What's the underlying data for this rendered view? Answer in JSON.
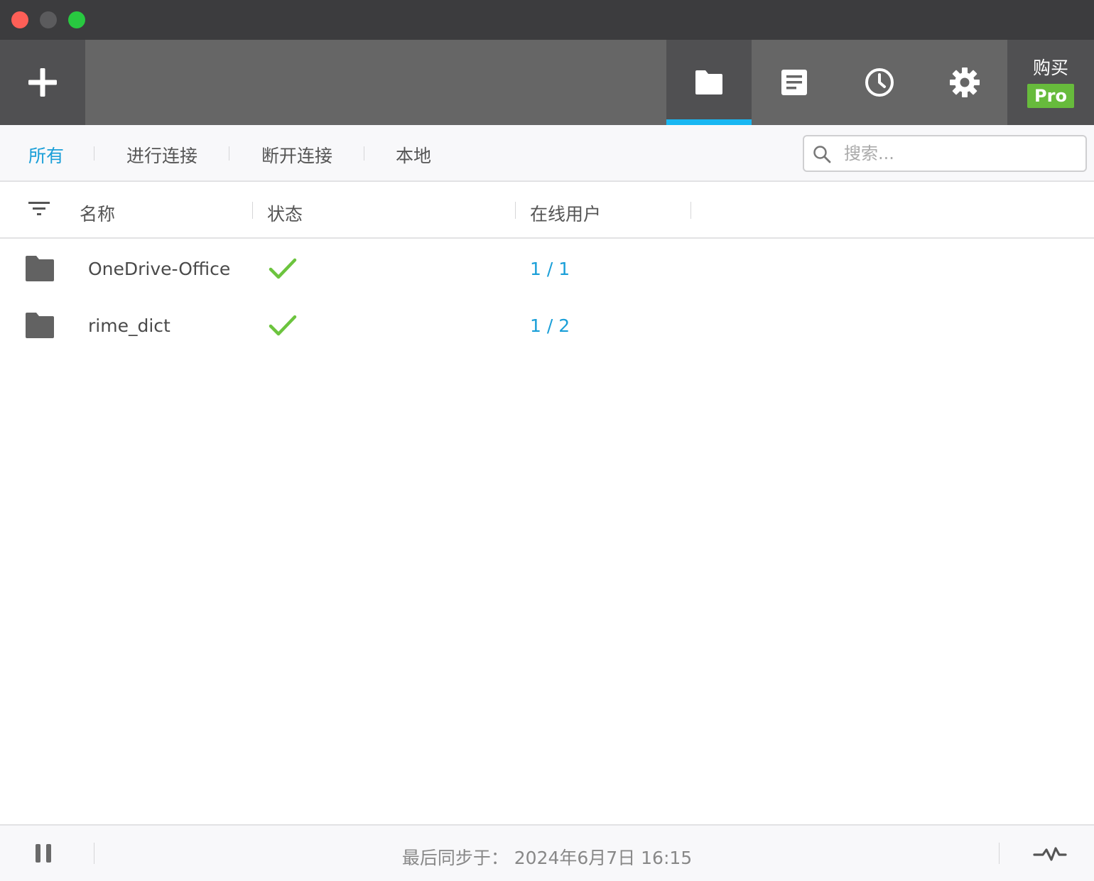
{
  "window": {
    "controls": [
      "close",
      "minimize",
      "maximize"
    ]
  },
  "toolbar": {
    "add_icon": "plus-icon",
    "tabs": [
      {
        "name": "folders",
        "icon": "folder-icon",
        "active": true
      },
      {
        "name": "logs",
        "icon": "document-icon",
        "active": false
      },
      {
        "name": "history",
        "icon": "clock-icon",
        "active": false
      },
      {
        "name": "settings",
        "icon": "gear-icon",
        "active": false
      }
    ],
    "buy_label": "购买",
    "pro_label": "Pro"
  },
  "filters": {
    "tabs": [
      {
        "label": "所有",
        "active": true
      },
      {
        "label": "进行连接",
        "active": false
      },
      {
        "label": "断开连接",
        "active": false
      },
      {
        "label": "本地",
        "active": false
      }
    ],
    "search_placeholder": "搜索..."
  },
  "table": {
    "columns": [
      "名称",
      "状态",
      "在线用户"
    ],
    "rows": [
      {
        "name": "OneDrive-Office",
        "status": "synced",
        "users": "1 / 1"
      },
      {
        "name": "rime_dict",
        "status": "synced",
        "users": "1 / 2"
      }
    ]
  },
  "statusbar": {
    "sync_text": "最后同步于：  2024年6月7日 16:15"
  },
  "colors": {
    "accent": "#19b7f2",
    "link": "#1a9fd8",
    "pro": "#67bb3c",
    "check": "#6cc43e",
    "toolbar": "#666666"
  }
}
